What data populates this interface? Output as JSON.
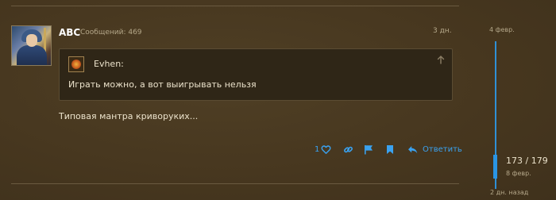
{
  "post": {
    "username": "ABC",
    "message_count": "Сообщений: 469",
    "date": "3 дн.",
    "quote": {
      "author": "Evhen:",
      "text": "Играть можно, а вот выигрывать нельзя",
      "expand_icon": "arrow-up-icon"
    },
    "body": "Типовая мантра криворуких...",
    "actions": {
      "like_count": "1",
      "like_icon": "heart-icon",
      "link_icon": "link-icon",
      "flag_icon": "flag-icon",
      "bookmark_icon": "bookmark-icon",
      "reply_icon": "reply-icon",
      "reply_label": "Ответить"
    }
  },
  "timeline": {
    "top_label": "4 февр.",
    "position": "173 / 179",
    "position_date": "8 февр.",
    "bottom_label": "2 дн. назад",
    "progress": 0.966
  },
  "colors": {
    "background": "#4a3a22",
    "accent": "#2a95e4",
    "text": "#ece3cc",
    "muted": "#b5a88a"
  }
}
